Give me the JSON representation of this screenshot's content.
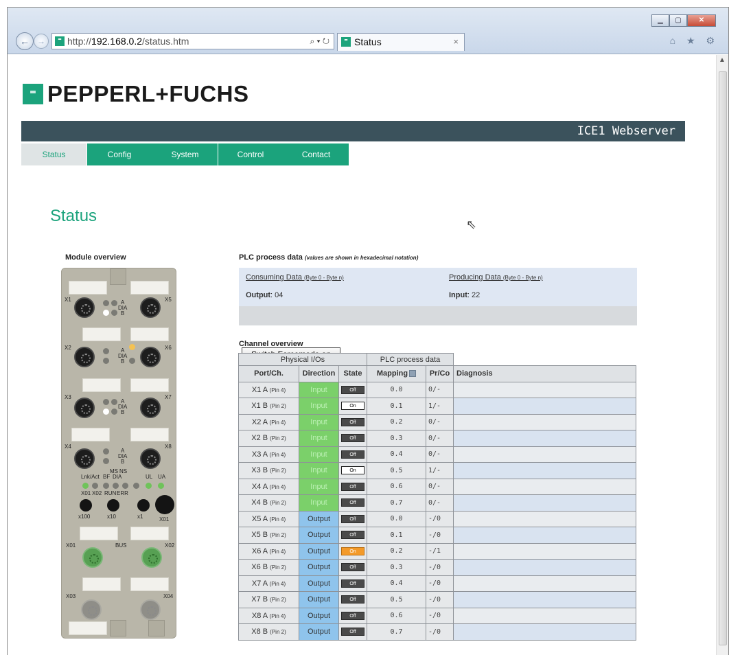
{
  "browser": {
    "address_prefix": "http://",
    "address_host": "192.168.0.2",
    "address_path": "/status.htm",
    "address_tools": "⌕ ▾ ↻",
    "tab_title": "Status",
    "tab_close": "×",
    "fav": "⁼",
    "win_min": "▁",
    "win_max": "▢",
    "win_close": "✕",
    "back": "←",
    "forward": "→",
    "toolbar_icons": "⌂ ★ ⚙"
  },
  "brand": {
    "logo_mark": "⁼",
    "name": "PEPPERL+FUCHS"
  },
  "banner": {
    "title": "ICE1 Webserver"
  },
  "nav": [
    "Status",
    "Config",
    "System",
    "Control",
    "Contact"
  ],
  "page_title": "Status",
  "module": {
    "title": "Module overview",
    "port_labels": [
      "X1",
      "X5",
      "X2",
      "X6",
      "X3",
      "X7",
      "X4",
      "X8"
    ],
    "led_a": "A",
    "led_dia": "DIA",
    "led_b": "B",
    "status_labels": {
      "lnk": "Lnk/Act",
      "bf": "BF",
      "ms": "MS",
      "ns": "NS",
      "dia": "DIA",
      "ul": "UL",
      "ua": "UA"
    },
    "bottom_labels": {
      "x01": "X01",
      "x02": "X02",
      "run": "RUN",
      "err": "ERR"
    },
    "switch_labels": [
      "x100",
      "x10",
      "x1",
      "X01"
    ],
    "bus_labels": {
      "x01": "X01",
      "bus": "BUS",
      "x02": "X02",
      "x03": "X03",
      "x04": "X04"
    }
  },
  "plc": {
    "title": "PLC process data",
    "note": "(values are shown in hexadecimal notation)",
    "consuming_label": "Consuming Data",
    "consuming_range": "(Byte 0 - Byte n)",
    "producing_label": "Producing Data",
    "producing_range": "(Byte 0 - Byte n)",
    "output_label": "Output",
    "output_value": ": 04",
    "input_label": "Input",
    "input_value": ": 22",
    "force_button": "Switch Forcemode on"
  },
  "channels": {
    "title": "Channel overview",
    "group_headers": [
      "Physical I/Os",
      "PLC process data"
    ],
    "headers": [
      "Port/Ch.",
      "Direction",
      "State",
      "Mapping",
      "Pr/Co",
      "Diagnosis"
    ],
    "rows": [
      {
        "port": "X1 A",
        "pin": "(Pin 4)",
        "direction": "Input",
        "state": "Off",
        "mapping": "0.0",
        "prco": "0/-"
      },
      {
        "port": "X1 B",
        "pin": "(Pin 2)",
        "direction": "Input",
        "state": "On",
        "mapping": "0.1",
        "prco": "1/-"
      },
      {
        "port": "X2 A",
        "pin": "(Pin 4)",
        "direction": "Input",
        "state": "Off",
        "mapping": "0.2",
        "prco": "0/-"
      },
      {
        "port": "X2 B",
        "pin": "(Pin 2)",
        "direction": "Input",
        "state": "Off",
        "mapping": "0.3",
        "prco": "0/-"
      },
      {
        "port": "X3 A",
        "pin": "(Pin 4)",
        "direction": "Input",
        "state": "Off",
        "mapping": "0.4",
        "prco": "0/-"
      },
      {
        "port": "X3 B",
        "pin": "(Pin 2)",
        "direction": "Input",
        "state": "On",
        "mapping": "0.5",
        "prco": "1/-"
      },
      {
        "port": "X4 A",
        "pin": "(Pin 4)",
        "direction": "Input",
        "state": "Off",
        "mapping": "0.6",
        "prco": "0/-"
      },
      {
        "port": "X4 B",
        "pin": "(Pin 2)",
        "direction": "Input",
        "state": "Off",
        "mapping": "0.7",
        "prco": "0/-"
      },
      {
        "port": "X5 A",
        "pin": "(Pin 4)",
        "direction": "Output",
        "state": "Off",
        "mapping": "0.0",
        "prco": "-/0"
      },
      {
        "port": "X5 B",
        "pin": "(Pin 2)",
        "direction": "Output",
        "state": "Off",
        "mapping": "0.1",
        "prco": "-/0"
      },
      {
        "port": "X6 A",
        "pin": "(Pin 4)",
        "direction": "Output",
        "state": "On",
        "mapping": "0.2",
        "prco": "-/1"
      },
      {
        "port": "X6 B",
        "pin": "(Pin 2)",
        "direction": "Output",
        "state": "Off",
        "mapping": "0.3",
        "prco": "-/0"
      },
      {
        "port": "X7 A",
        "pin": "(Pin 4)",
        "direction": "Output",
        "state": "Off",
        "mapping": "0.4",
        "prco": "-/0"
      },
      {
        "port": "X7 B",
        "pin": "(Pin 2)",
        "direction": "Output",
        "state": "Off",
        "mapping": "0.5",
        "prco": "-/0"
      },
      {
        "port": "X8 A",
        "pin": "(Pin 4)",
        "direction": "Output",
        "state": "Off",
        "mapping": "0.6",
        "prco": "-/0"
      },
      {
        "port": "X8 B",
        "pin": "(Pin 2)",
        "direction": "Output",
        "state": "Off",
        "mapping": "0.7",
        "prco": "-/0"
      }
    ]
  },
  "colors": {
    "brand_green": "#1ba37c",
    "banner": "#3b525c",
    "input": "#7bd06a",
    "output": "#8fc4ec",
    "state_on_output": "#f39a2a"
  }
}
